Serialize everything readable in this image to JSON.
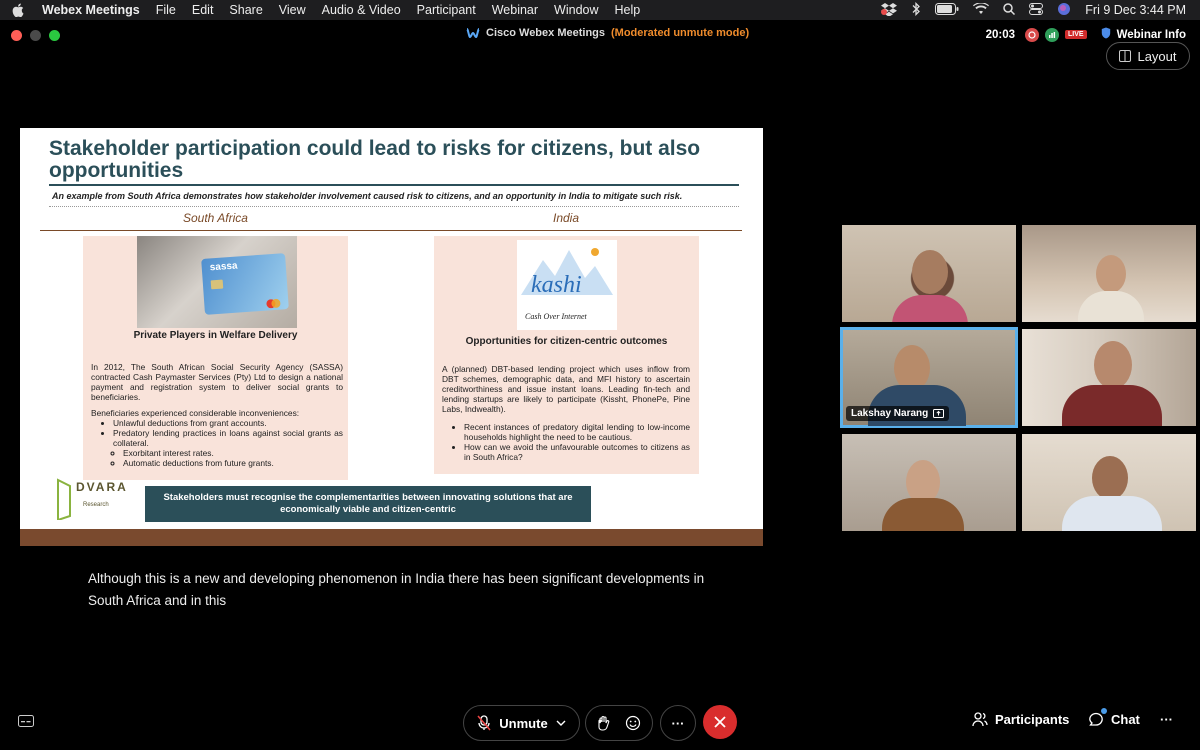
{
  "menubar": {
    "app": "Webex Meetings",
    "items": [
      "File",
      "Edit",
      "Share",
      "View",
      "Audio & Video",
      "Participant",
      "Webinar",
      "Window",
      "Help"
    ],
    "clock": "Fri 9 Dec  3:44 PM"
  },
  "titlebar": {
    "title": "Cisco Webex Meetings",
    "mode": "(Moderated unmute mode)",
    "timer": "20:03",
    "live": "LIVE",
    "webinar_info": "Webinar Info"
  },
  "layout_label": "Layout",
  "slide": {
    "title": "Stakeholder participation could lead to risks for citizens, but also opportunities",
    "subtitle": "An example from South Africa demonstrates how stakeholder involvement caused risk to citizens, and an opportunity in India to mitigate such risk.",
    "left": {
      "heading": "South Africa",
      "card_brand": "sassa",
      "panel_title": "Private Players in Welfare Delivery",
      "para": "In 2012, The South African Social Security Agency (SASSA) contracted Cash Paymaster Services (Pty) Ltd to design a national payment and registration system to deliver social grants to beneficiaries.",
      "para2": "Beneficiaries experienced considerable inconveniences:",
      "bullets": [
        "Unlawful deductions from grant accounts.",
        "Predatory lending practices in loans against social grants as collateral."
      ],
      "sub_bullets": [
        "Exorbitant interest rates.",
        "Automatic deductions from future grants."
      ]
    },
    "right": {
      "heading": "India",
      "logo_word": "kashi",
      "logo_tag": "Cash Over Internet",
      "panel_title": "Opportunities for citizen-centric outcomes",
      "para": "A (planned) DBT-based lending project which uses inflow from DBT schemes, demographic data, and MFI history to ascertain creditworthiness and issue instant loans. Leading fin-tech and lending startups are likely to participate (Kissht, PhonePe, Pine Labs, Indwealth).",
      "bullets": [
        "Recent instances of predatory digital lending to low-income households highlight the need to be cautious.",
        "How can we avoid the unfavourable outcomes to citizens as in South Africa?"
      ]
    },
    "logo": {
      "name": "DVARA",
      "sub": "Research"
    },
    "callout": "Stakeholders must recognise the complementarities between innovating solutions that are economically viable and citizen-centric"
  },
  "caption": "Although this is a new and developing phenomenon in India there has been significant developments in South Africa and in this",
  "participants": [
    {
      "name": ""
    },
    {
      "name": ""
    },
    {
      "name": "Lakshay Narang"
    },
    {
      "name": ""
    },
    {
      "name": ""
    },
    {
      "name": ""
    }
  ],
  "toolbar": {
    "unmute": "Unmute",
    "more": "···",
    "participants": "Participants",
    "chat": "Chat",
    "overflow": "···"
  },
  "colors": {
    "accent": "#2b4f59",
    "brown": "#7a4a2e",
    "panel": "#f9e3da",
    "end": "#d92d2d",
    "active_border": "#5ab0ea",
    "mode": "#f08c2c"
  }
}
